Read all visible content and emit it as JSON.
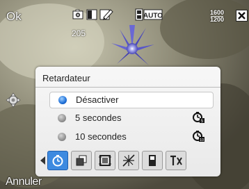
{
  "softkeys": {
    "left": "Ok",
    "bottom_left": "Annuler"
  },
  "status": {
    "shot_counter": "205",
    "resolution_top": "1600",
    "resolution_bottom": "1200",
    "flash_mode_label": "AUTO"
  },
  "dialog": {
    "title": "Retardateur",
    "options": [
      {
        "label": "Désactiver",
        "selected": true
      },
      {
        "label": "5 secondes",
        "selected": false,
        "icon": "timer-5s-icon"
      },
      {
        "label": "10 secondes",
        "selected": false,
        "icon": "timer-10s-icon"
      }
    ],
    "tabs": [
      {
        "name": "self-timer-tab",
        "icon": "timer-icon",
        "active": true
      },
      {
        "name": "burst-tab",
        "icon": "burst-icon",
        "active": false
      },
      {
        "name": "frame-tab",
        "icon": "frame-icon",
        "active": false
      },
      {
        "name": "white-balance-tab",
        "icon": "white-balance-icon",
        "active": false
      },
      {
        "name": "flash-tab",
        "icon": "flash-icon",
        "active": false
      },
      {
        "name": "tools-tab",
        "icon": "tools-icon",
        "active": false
      }
    ]
  },
  "colors": {
    "accent": "#3d8ae0",
    "panel": "#efefef"
  }
}
